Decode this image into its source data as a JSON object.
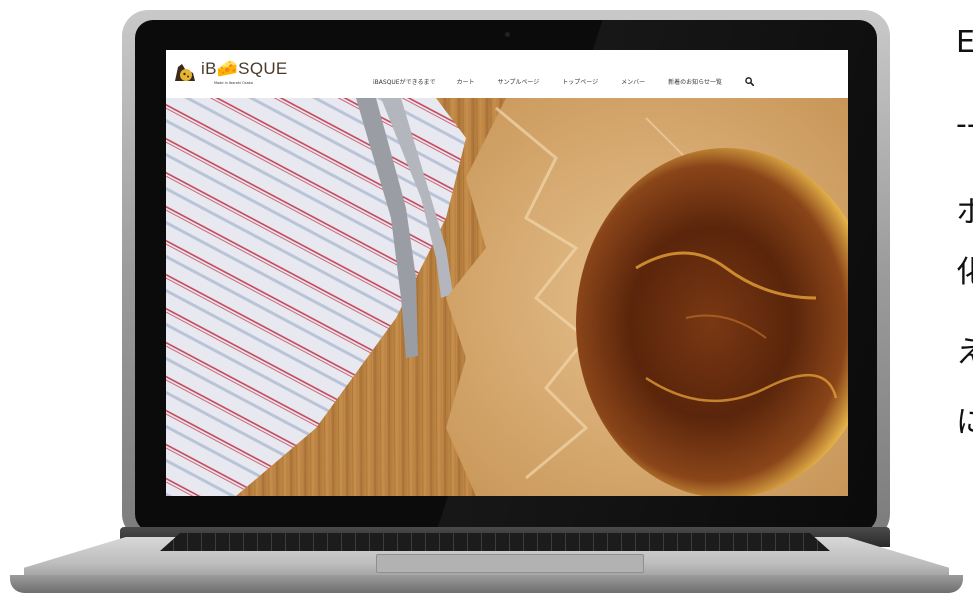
{
  "site": {
    "logo_text": "iB🧀SQUE",
    "logo_tagline": "Made in Ibaraki Osaka"
  },
  "nav": {
    "items": [
      {
        "label": "iBASQUEができるまで"
      },
      {
        "label": "カート"
      },
      {
        "label": "サンプルページ"
      },
      {
        "label": "トップページ"
      },
      {
        "label": "メンバー"
      },
      {
        "label": "新着のお知らせ一覧"
      }
    ],
    "search_icon": "search-icon"
  },
  "side_text": {
    "line1": "E",
    "line2": "--",
    "line3": "ホ",
    "line4": "化",
    "line5": "え",
    "line6": "に"
  },
  "colors": {
    "header_bg": "#ffffff",
    "logo_brown": "#4a3b2a",
    "accent_gold": "#e7b431"
  }
}
